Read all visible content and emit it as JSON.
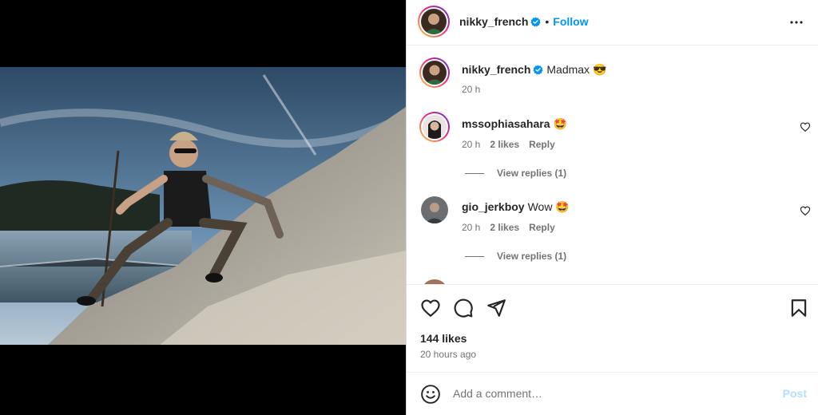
{
  "post": {
    "author": "nikky_french",
    "follow_label": "Follow",
    "separator": "•",
    "caption": {
      "username": "nikky_french",
      "text": "Madmax 😎",
      "time": "20 h"
    }
  },
  "comments": [
    {
      "username": "mssophiasahara",
      "text": "🤩",
      "time": "20 h",
      "likes": "2 likes",
      "reply_label": "Reply",
      "view_replies": "View replies (1)"
    },
    {
      "username": "gio_jerkboy",
      "text": "Wow 🤩",
      "time": "20 h",
      "likes": "2 likes",
      "reply_label": "Reply",
      "view_replies": "View replies (1)"
    }
  ],
  "stats": {
    "likes": "144 likes",
    "posted": "20 hours ago"
  },
  "composer": {
    "placeholder": "Add a comment…",
    "post_label": "Post"
  },
  "icons": {
    "verified": "verified-badge-icon",
    "more": "more-options-icon",
    "like": "heart-icon",
    "comment": "comment-icon",
    "share": "share-icon",
    "save": "bookmark-icon",
    "emoji": "emoji-icon"
  },
  "colors": {
    "accent": "#0095f6",
    "verified": "#0095f6",
    "post_disabled": "#b2dffc",
    "muted": "#737373"
  }
}
